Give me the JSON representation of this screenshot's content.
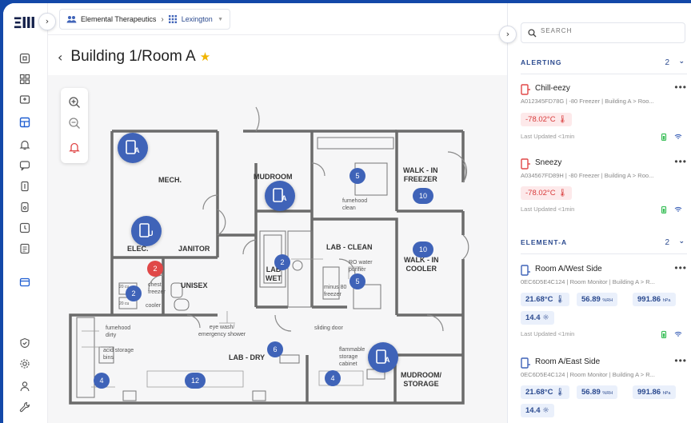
{
  "app": {
    "logo": "Ξlll"
  },
  "breadcrumb": {
    "org": "Elemental Therapeutics",
    "site": "Lexington"
  },
  "page": {
    "title": "Building 1/Room A"
  },
  "map": {
    "rooms": {
      "mech": "MECH.",
      "mudroom": "MUDROOM",
      "walkin_freezer": "WALK - IN\nFREEZER",
      "elec": "ELEC.",
      "janitor": "JANITOR",
      "unisex": "UNISEX",
      "lab_clean": "LAB - CLEAN",
      "lab_wet": "LAB\nWET",
      "walkin_cooler": "WALK - IN\nCOOLER",
      "lab_dry": "LAB - DRY",
      "mudroom_storage": "MUDROOM/\nSTORAGE"
    },
    "notes": {
      "fumehood_clean": "fumehood\nclean",
      "ro_water": "RO water\npurifier",
      "minus80": "minus 80\nfreezer",
      "chest_freezer": "chest\nfreezer",
      "cooler": "cooler",
      "label_20a": "20 cu",
      "label_20b": "20 cu",
      "eyewash": "eye wash/\nemergency shower",
      "sliding_door": "sliding door",
      "fumehood_dirty": "fumehood\ndirty",
      "acid_storage": "acid storage\nbins",
      "flammable": "flammable\nstorage\ncabinet"
    },
    "counts": {
      "mudroom_top": "5",
      "walkin_freezer": "10",
      "janitor_alert": "2",
      "unisex": "2",
      "lab_wet": "2",
      "lab_clean": "5",
      "walkin_cooler": "10",
      "lab_dry": "6",
      "dry_left": "4",
      "dry_mid": "12",
      "dry_right": "4"
    },
    "device_badges": {
      "mech": "A",
      "elec": "U",
      "mudroom": "A",
      "storage": "A"
    }
  },
  "panel": {
    "search_placeholder": "SEARCH",
    "sections": [
      {
        "title": "ALERTING",
        "count": "2",
        "items": [
          {
            "name": "Chill-eezy",
            "meta": "A012345FD78G | -80 Freezer | Building A > Roo...",
            "reading": "-78.02°C",
            "updated": "Last Updated <1min"
          },
          {
            "name": "Sneezy",
            "meta": "A034567FD89H | -80 Freezer | Building A > Roo...",
            "reading": "-78.02°C",
            "updated": "Last Updated <1min"
          }
        ]
      },
      {
        "title": "ELEMENT-A",
        "count": "2",
        "items": [
          {
            "name": "Room A/West Side",
            "meta": "0EC6D5E4C124 | Room Monitor | Building A > R...",
            "temp": "21.68°C",
            "humidity": "56.89",
            "humidity_unit": "%RH",
            "pressure": "991.86",
            "pressure_unit": "hPa",
            "light": "14.4",
            "updated": "Last Updated <1min"
          },
          {
            "name": "Room A/East Side",
            "meta": "0EC6D5E4C124 | Room Monitor | Building A > R...",
            "temp": "21.68°C",
            "humidity": "56.89",
            "humidity_unit": "%RH",
            "pressure": "991.86",
            "pressure_unit": "hPa",
            "light": "14.4"
          }
        ]
      }
    ]
  },
  "colors": {
    "background": "#1348a8",
    "accent": "#3f63b8",
    "alert": "#e04848",
    "star": "#f0b400",
    "ok_green": "#3cbf5a"
  }
}
